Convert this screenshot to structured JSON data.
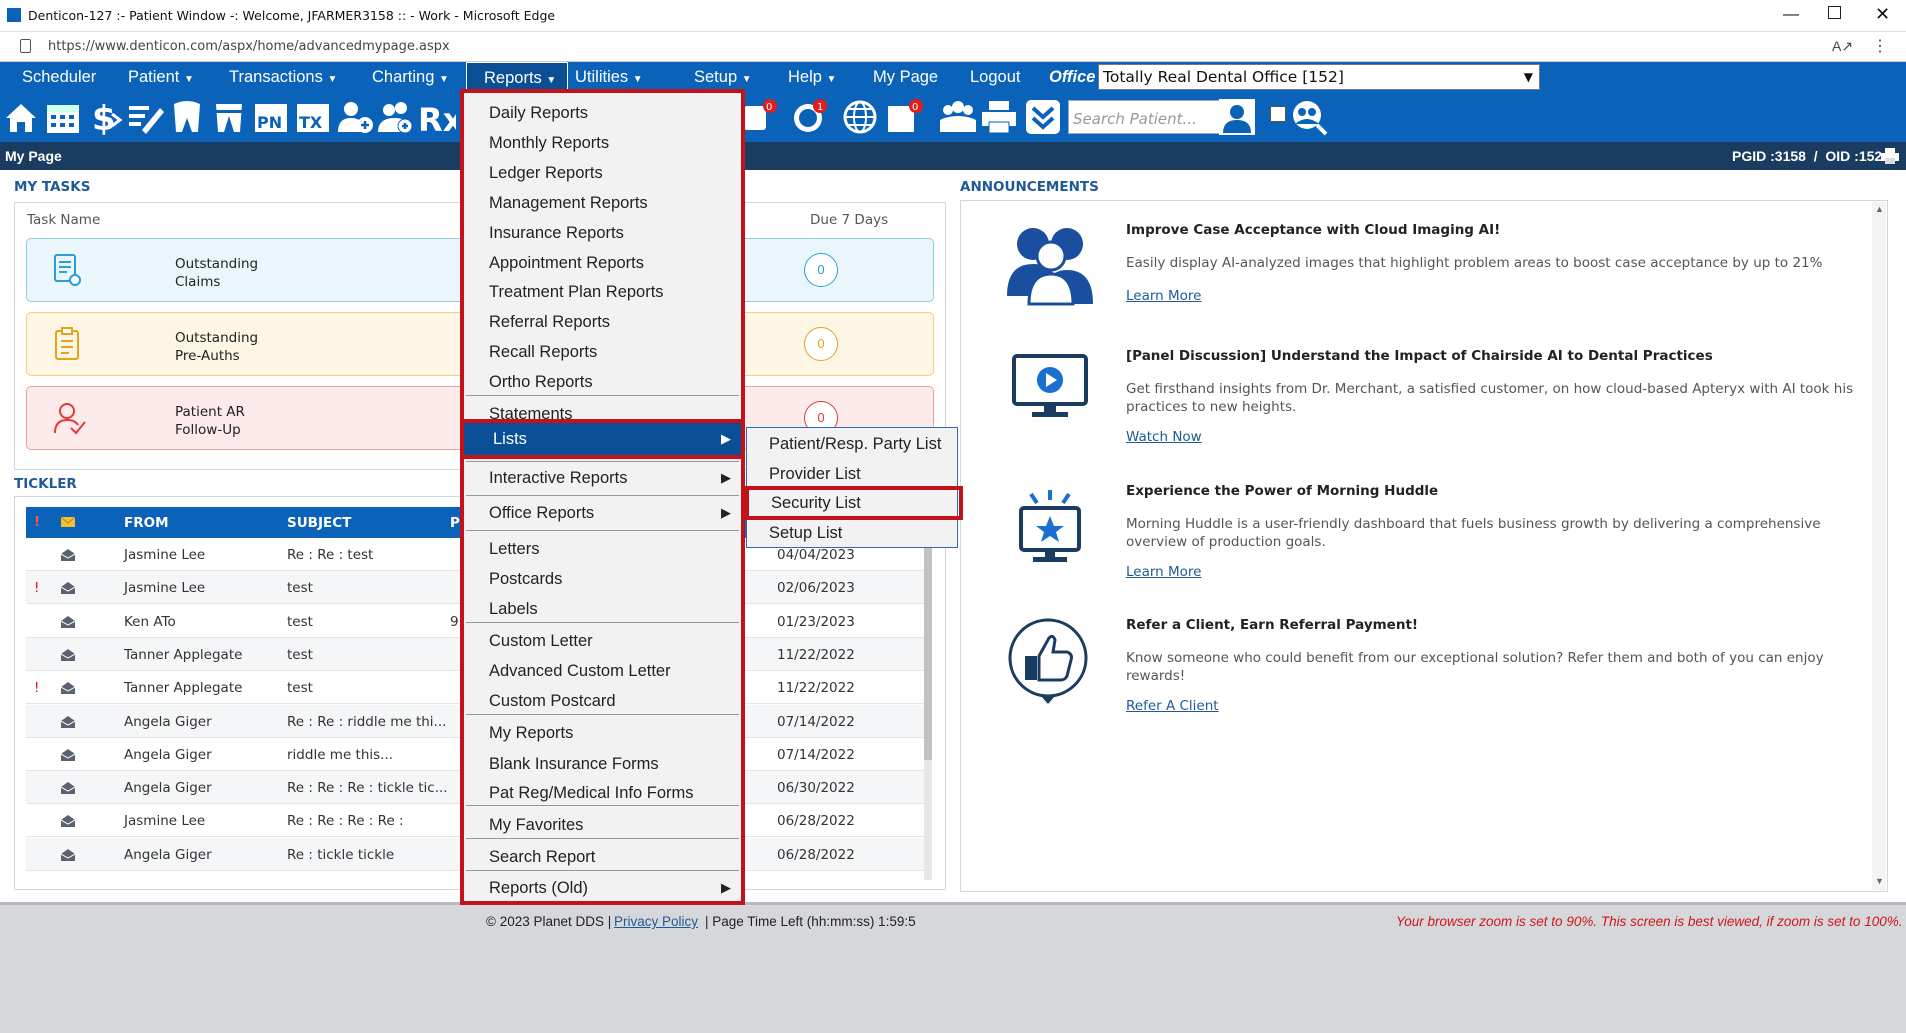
{
  "window": {
    "title": "Denticon-127 :- Patient Window -: Welcome, JFARMER3158 :: - Work - Microsoft Edge",
    "url": "https://www.denticon.com/aspx/home/advancedmypage.aspx"
  },
  "menu": {
    "items": [
      "Scheduler",
      "Patient",
      "Transactions",
      "Charting",
      "Reports",
      "Utilities",
      "Setup",
      "Help",
      "My Page",
      "Logout"
    ],
    "office_label": "Office",
    "office_value": "Totally Real Dental Office [152]"
  },
  "toolbar": {
    "search_placeholder": "Search Patient...",
    "badges": [
      "0",
      "1",
      "0"
    ]
  },
  "mypage": {
    "title": "My Page",
    "pgid": "PGID :3158  /  OID :152"
  },
  "tasks": {
    "title": "MY TASKS",
    "col_task": "Task Name",
    "col_due": "Due 7 Days",
    "items": [
      {
        "label": "Outstanding\nClaims",
        "count": "0"
      },
      {
        "label": "Outstanding\nPre-Auths",
        "count": "0"
      },
      {
        "label": "Patient AR\nFollow-Up",
        "count": "0"
      }
    ]
  },
  "tickler": {
    "title": "TICKLER",
    "headers": {
      "from": "FROM",
      "subject": "SUBJECT",
      "p": "P"
    },
    "rows": [
      {
        "flag": "",
        "from": "Jasmine Lee",
        "subject": "Re : Re : test",
        "p": "",
        "date": "04/04/2023"
      },
      {
        "flag": "!",
        "from": "Jasmine Lee",
        "subject": "test",
        "p": "",
        "date": "02/06/2023"
      },
      {
        "flag": "",
        "from": "Ken ATo",
        "subject": "test",
        "p": "9",
        "date": "01/23/2023"
      },
      {
        "flag": "",
        "from": "Tanner Applegate",
        "subject": "test",
        "p": "",
        "date": "11/22/2022"
      },
      {
        "flag": "!",
        "from": "Tanner Applegate",
        "subject": "test",
        "p": "",
        "date": "11/22/2022"
      },
      {
        "flag": "",
        "from": "Angela Giger",
        "subject": "Re : Re : riddle me thi...",
        "p": "",
        "date": "07/14/2022"
      },
      {
        "flag": "",
        "from": "Angela Giger",
        "subject": "riddle me this...",
        "p": "",
        "date": "07/14/2022"
      },
      {
        "flag": "",
        "from": "Angela Giger",
        "subject": "Re : Re : Re : tickle tic...",
        "p": "",
        "date": "06/30/2022"
      },
      {
        "flag": "",
        "from": "Jasmine Lee",
        "subject": "Re : Re : Re : Re :",
        "p": "",
        "date": "06/28/2022"
      },
      {
        "flag": "",
        "from": "Angela Giger",
        "subject": "Re : tickle tickle",
        "p": "",
        "date": "06/28/2022"
      }
    ]
  },
  "announcements": {
    "title": "ANNOUNCEMENTS",
    "items": [
      {
        "heading": "Improve Case Acceptance with Cloud Imaging AI!",
        "body": "Easily display AI-analyzed images that highlight problem areas to boost case acceptance by up to 21%",
        "link": "Learn More"
      },
      {
        "heading": "[Panel Discussion] Understand the Impact of Chairside AI to Dental Practices",
        "body": "Get firsthand insights from Dr. Merchant, a satisfied customer, on how cloud-based Apteryx with AI took his practices to new heights.",
        "link": "Watch Now"
      },
      {
        "heading": "Experience the Power of Morning Huddle",
        "body": "Morning Huddle is a user-friendly dashboard that fuels business growth by delivering a comprehensive overview of production goals.",
        "link": "Learn More"
      },
      {
        "heading": "Refer a Client, Earn Referral Payment!",
        "body": "Know someone who could benefit from our exceptional solution? Refer them and both of you can enjoy rewards!",
        "link": "Refer A Client"
      }
    ]
  },
  "reports_menu": {
    "items": [
      "Daily Reports",
      "Monthly Reports",
      "Ledger Reports",
      "Management Reports",
      "Insurance Reports",
      "Appointment Reports",
      "Treatment Plan Reports",
      "Referral Reports",
      "Recall Reports",
      "Ortho Reports",
      "Statements",
      "Lists",
      "Interactive Reports",
      "Office Reports",
      "Letters",
      "Postcards",
      "Labels",
      "Custom Letter",
      "Advanced Custom Letter",
      "Custom Postcard",
      "My Reports",
      "Blank Insurance Forms",
      "Pat Reg/Medical Info Forms",
      "My Favorites",
      "Search Report",
      "Reports (Old)"
    ]
  },
  "lists_submenu": {
    "items": [
      "Patient/Resp. Party List",
      "Provider List",
      "Security List",
      "Setup List"
    ]
  },
  "footer": {
    "copyright": "© 2023 Planet DDS |",
    "privacy": "Privacy Policy",
    "page_time": "| Page Time Left (hh:mm:ss) 1:59:5",
    "zoom_warning": "Your browser zoom is set to 90%. This screen is best viewed, if zoom is set to 100%."
  },
  "colors": {
    "nav": "#0a63b8",
    "highlight": "#c4121a",
    "dark_bar": "#1b3c61"
  }
}
